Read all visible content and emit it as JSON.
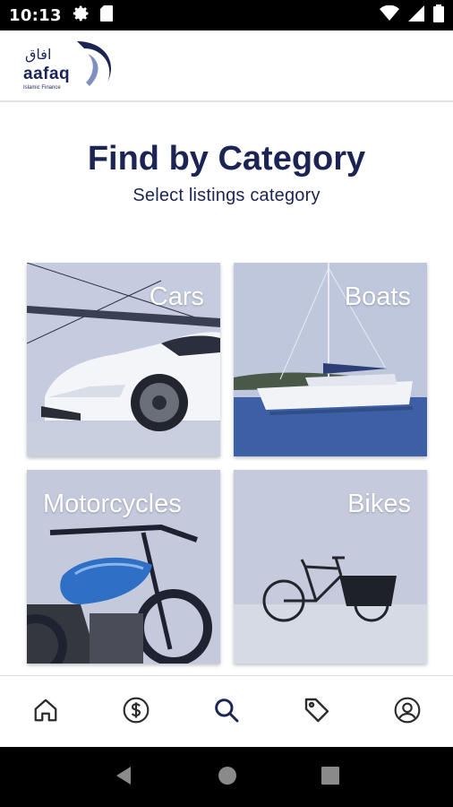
{
  "status_bar": {
    "time": "10:13",
    "left_icons": [
      "gear-icon",
      "sd-card-icon"
    ],
    "right_icons": [
      "wifi-icon",
      "signal-icon",
      "battery-icon"
    ]
  },
  "header": {
    "logo_icon": "aafaq-logo",
    "logo_text": "aafaq",
    "logo_arabic": "افاق",
    "logo_tagline": "Islamic Finance"
  },
  "page": {
    "title": "Find by Category",
    "subtitle": "Select listings category"
  },
  "categories": [
    {
      "label": "Cars",
      "image": "white-car"
    },
    {
      "label": "Boats",
      "image": "sailboat"
    },
    {
      "label": "Motorcycles",
      "image": "blue-motorcycle"
    },
    {
      "label": "Bikes",
      "image": "cargo-bike"
    }
  ],
  "bottom_nav": [
    {
      "icon": "home-icon",
      "active": false
    },
    {
      "icon": "dollar-icon",
      "active": false
    },
    {
      "icon": "search-icon",
      "active": true
    },
    {
      "icon": "tag-icon",
      "active": false
    },
    {
      "icon": "profile-icon",
      "active": false
    }
  ],
  "system_nav": [
    "back-icon",
    "home-circle-icon",
    "recents-icon"
  ],
  "colors": {
    "brand_navy": "#1c2456",
    "nav_icon": "#2b2b2b",
    "nav_active": "#1c2456",
    "tile_overlay": "#b8c0d8"
  }
}
